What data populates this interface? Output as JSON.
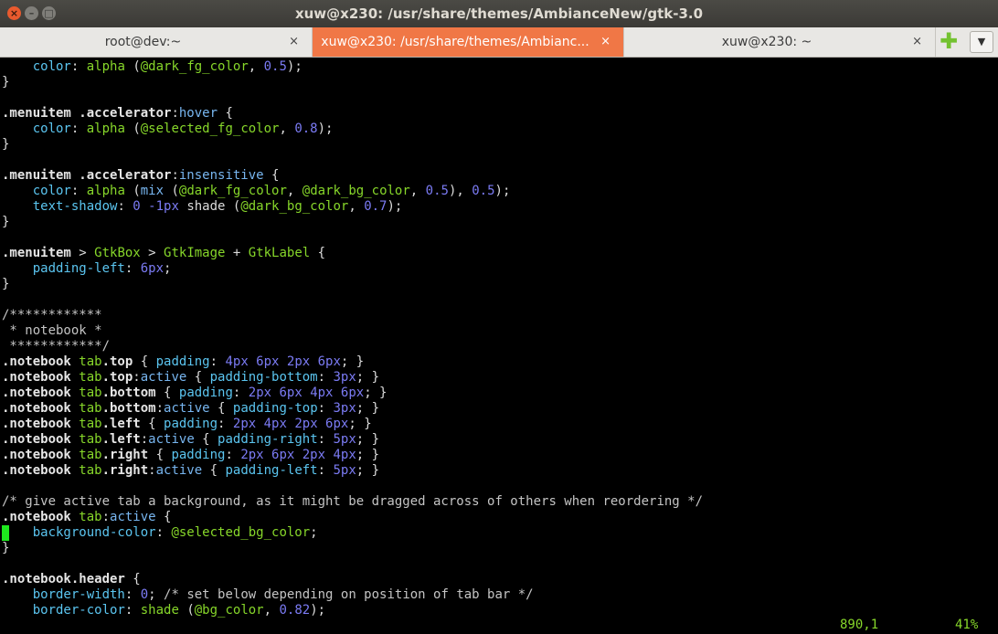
{
  "window": {
    "title": "xuw@x230: /usr/share/themes/AmbianceNew/gtk-3.0",
    "close_glyph": "×",
    "minimize_glyph": "–",
    "maximize_glyph": "□"
  },
  "tabs": [
    {
      "label": "root@dev:~",
      "close": "×"
    },
    {
      "label": "xuw@x230: /usr/share/themes/Ambianc...",
      "close": "×"
    },
    {
      "label": "xuw@x230: ~",
      "close": "×"
    }
  ],
  "tabbar": {
    "new_tab_glyph": "✚",
    "menu_glyph": "▼"
  },
  "colors": {
    "accent_tab": "#f07746",
    "keyword": "#87d72a",
    "property": "#5bc5f0",
    "number": "#7b7bf4",
    "cursor": "#1ee81e"
  },
  "lines": [
    [
      [
        "    ",
        "s"
      ],
      [
        "color",
        "p"
      ],
      [
        ": ",
        "s"
      ],
      [
        "alpha",
        "k"
      ],
      [
        " (",
        "s"
      ],
      [
        "@dark_fg_color",
        "k"
      ],
      [
        ", ",
        "s"
      ],
      [
        "0.5",
        "n"
      ],
      [
        ");",
        "s"
      ]
    ],
    [
      [
        "}",
        "s"
      ]
    ],
    [
      [
        "",
        "s"
      ]
    ],
    [
      [
        ".menuitem .accelerator",
        "sel"
      ],
      [
        ":",
        "s"
      ],
      [
        "hover",
        "v"
      ],
      [
        " {",
        "s"
      ]
    ],
    [
      [
        "    ",
        "s"
      ],
      [
        "color",
        "p"
      ],
      [
        ": ",
        "s"
      ],
      [
        "alpha",
        "k"
      ],
      [
        " (",
        "s"
      ],
      [
        "@selected_fg_color",
        "k"
      ],
      [
        ", ",
        "s"
      ],
      [
        "0.8",
        "n"
      ],
      [
        ");",
        "s"
      ]
    ],
    [
      [
        "}",
        "s"
      ]
    ],
    [
      [
        "",
        "s"
      ]
    ],
    [
      [
        ".menuitem .accelerator",
        "sel"
      ],
      [
        ":",
        "s"
      ],
      [
        "insensitive",
        "v"
      ],
      [
        " {",
        "s"
      ]
    ],
    [
      [
        "    ",
        "s"
      ],
      [
        "color",
        "p"
      ],
      [
        ": ",
        "s"
      ],
      [
        "alpha",
        "k"
      ],
      [
        " (",
        "s"
      ],
      [
        "mix",
        "v"
      ],
      [
        " (",
        "s"
      ],
      [
        "@dark_fg_color",
        "k"
      ],
      [
        ", ",
        "s"
      ],
      [
        "@dark_bg_color",
        "k"
      ],
      [
        ", ",
        "s"
      ],
      [
        "0.5",
        "n"
      ],
      [
        "), ",
        "s"
      ],
      [
        "0.5",
        "n"
      ],
      [
        ");",
        "s"
      ]
    ],
    [
      [
        "    ",
        "s"
      ],
      [
        "text-shadow",
        "p"
      ],
      [
        ": ",
        "s"
      ],
      [
        "0",
        "n"
      ],
      [
        " ",
        "s"
      ],
      [
        "-1px",
        "n"
      ],
      [
        " shade (",
        "s"
      ],
      [
        "@dark_bg_color",
        "k"
      ],
      [
        ", ",
        "s"
      ],
      [
        "0.7",
        "n"
      ],
      [
        ");",
        "s"
      ]
    ],
    [
      [
        "}",
        "s"
      ]
    ],
    [
      [
        "",
        "s"
      ]
    ],
    [
      [
        ".menuitem",
        "sel"
      ],
      [
        " > ",
        "s"
      ],
      [
        "GtkBox",
        "k"
      ],
      [
        " > ",
        "s"
      ],
      [
        "GtkImage",
        "k"
      ],
      [
        " + ",
        "s"
      ],
      [
        "GtkLabel",
        "k"
      ],
      [
        " {",
        "s"
      ]
    ],
    [
      [
        "    ",
        "s"
      ],
      [
        "padding-left",
        "p"
      ],
      [
        ": ",
        "s"
      ],
      [
        "6px",
        "n"
      ],
      [
        ";",
        "s"
      ]
    ],
    [
      [
        "}",
        "s"
      ]
    ],
    [
      [
        "",
        "s"
      ]
    ],
    [
      [
        "/************",
        "c"
      ]
    ],
    [
      [
        " * notebook *",
        "c"
      ]
    ],
    [
      [
        " ************/",
        "c"
      ]
    ],
    [
      [
        ".notebook",
        "sel"
      ],
      [
        " tab",
        "k"
      ],
      [
        ".top",
        "sel"
      ],
      [
        " { ",
        "s"
      ],
      [
        "padding",
        "p"
      ],
      [
        ": ",
        "s"
      ],
      [
        "4px 6px 2px 6px",
        "n"
      ],
      [
        "; }",
        "s"
      ]
    ],
    [
      [
        ".notebook",
        "sel"
      ],
      [
        " tab",
        "k"
      ],
      [
        ".top",
        "sel"
      ],
      [
        ":",
        "s"
      ],
      [
        "active",
        "v"
      ],
      [
        " { ",
        "s"
      ],
      [
        "padding-bottom",
        "p"
      ],
      [
        ": ",
        "s"
      ],
      [
        "3px",
        "n"
      ],
      [
        "; }",
        "s"
      ]
    ],
    [
      [
        ".notebook",
        "sel"
      ],
      [
        " tab",
        "k"
      ],
      [
        ".bottom",
        "sel"
      ],
      [
        " { ",
        "s"
      ],
      [
        "padding",
        "p"
      ],
      [
        ": ",
        "s"
      ],
      [
        "2px 6px 4px 6px",
        "n"
      ],
      [
        "; }",
        "s"
      ]
    ],
    [
      [
        ".notebook",
        "sel"
      ],
      [
        " tab",
        "k"
      ],
      [
        ".bottom",
        "sel"
      ],
      [
        ":",
        "s"
      ],
      [
        "active",
        "v"
      ],
      [
        " { ",
        "s"
      ],
      [
        "padding-top",
        "p"
      ],
      [
        ": ",
        "s"
      ],
      [
        "3px",
        "n"
      ],
      [
        "; }",
        "s"
      ]
    ],
    [
      [
        ".notebook",
        "sel"
      ],
      [
        " tab",
        "k"
      ],
      [
        ".left",
        "sel"
      ],
      [
        " { ",
        "s"
      ],
      [
        "padding",
        "p"
      ],
      [
        ": ",
        "s"
      ],
      [
        "2px 4px 2px 6px",
        "n"
      ],
      [
        "; }",
        "s"
      ]
    ],
    [
      [
        ".notebook",
        "sel"
      ],
      [
        " tab",
        "k"
      ],
      [
        ".left",
        "sel"
      ],
      [
        ":",
        "s"
      ],
      [
        "active",
        "v"
      ],
      [
        " { ",
        "s"
      ],
      [
        "padding-right",
        "p"
      ],
      [
        ": ",
        "s"
      ],
      [
        "5px",
        "n"
      ],
      [
        "; }",
        "s"
      ]
    ],
    [
      [
        ".notebook",
        "sel"
      ],
      [
        " tab",
        "k"
      ],
      [
        ".right",
        "sel"
      ],
      [
        " { ",
        "s"
      ],
      [
        "padding",
        "p"
      ],
      [
        ": ",
        "s"
      ],
      [
        "2px 6px 2px 4px",
        "n"
      ],
      [
        "; }",
        "s"
      ]
    ],
    [
      [
        ".notebook",
        "sel"
      ],
      [
        " tab",
        "k"
      ],
      [
        ".right",
        "sel"
      ],
      [
        ":",
        "s"
      ],
      [
        "active",
        "v"
      ],
      [
        " { ",
        "s"
      ],
      [
        "padding-left",
        "p"
      ],
      [
        ": ",
        "s"
      ],
      [
        "5px",
        "n"
      ],
      [
        "; }",
        "s"
      ]
    ],
    [
      [
        "",
        "s"
      ]
    ],
    [
      [
        "/* give active tab a background, as it might be dragged across of others when reordering */",
        "c"
      ]
    ],
    [
      [
        ".notebook",
        "sel"
      ],
      [
        " tab",
        "k"
      ],
      [
        ":",
        "s"
      ],
      [
        "active",
        "v"
      ],
      [
        " {",
        "s"
      ]
    ],
    [
      [
        "    ",
        "s"
      ],
      [
        "background-color",
        "p"
      ],
      [
        ": ",
        "s"
      ],
      [
        "@selected_bg_color",
        "k"
      ],
      [
        ";",
        "s"
      ]
    ],
    [
      [
        "}",
        "s"
      ]
    ],
    [
      [
        "",
        "s"
      ]
    ],
    [
      [
        ".notebook.header",
        "sel"
      ],
      [
        " {",
        "s"
      ]
    ],
    [
      [
        "    ",
        "s"
      ],
      [
        "border-width",
        "p"
      ],
      [
        ": ",
        "s"
      ],
      [
        "0",
        "n"
      ],
      [
        "; ",
        "s"
      ],
      [
        "/* set below depending on position of tab bar */",
        "c"
      ]
    ],
    [
      [
        "    ",
        "s"
      ],
      [
        "border-color",
        "p"
      ],
      [
        ": ",
        "s"
      ],
      [
        "shade",
        "k"
      ],
      [
        " (",
        "s"
      ],
      [
        "@bg_color",
        "k"
      ],
      [
        ", ",
        "s"
      ],
      [
        "0.82",
        "n"
      ],
      [
        ");",
        "s"
      ]
    ]
  ],
  "status": {
    "position": "890,1",
    "percent": "41%"
  }
}
